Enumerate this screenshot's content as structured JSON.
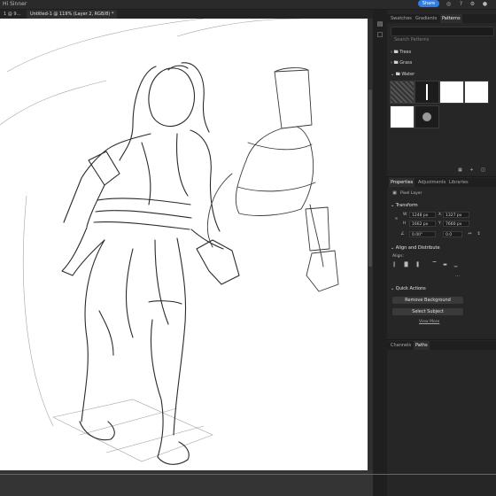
{
  "app_title": "Hi Sinner",
  "header": {
    "share_label": "Share",
    "icons": [
      "bell-icon",
      "help-icon",
      "settings-icon",
      "user-icon"
    ]
  },
  "document_tabs": {
    "prev_tab": "1 @ 9...",
    "active_tab": "Untitled-1 @ 119% (Layer 2, RGB/8) *"
  },
  "right_panel": {
    "top_tabs": [
      "Swatches",
      "Gradients",
      "Patterns"
    ],
    "search_placeholder": "Search Patterns",
    "groups": [
      "Trees",
      "Grass",
      "Water"
    ],
    "properties_tabs": [
      "Properties",
      "Adjustments",
      "Libraries"
    ],
    "layer_type": "Pixel Layer",
    "transform": {
      "section": "Transform",
      "w": "1248 px",
      "x": "1327 px",
      "h": "1662 px",
      "y": "7660 px",
      "angle": "0.00°",
      "angle_right": "0.0"
    },
    "align": {
      "section": "Align and Distribute",
      "align_label": "Align:"
    },
    "quick_actions": {
      "section": "Quick Actions",
      "remove_bg": "Remove Background",
      "select_subject": "Select Subject",
      "view_more": "View More"
    },
    "bottom_tabs": [
      "Channels",
      "Paths"
    ]
  }
}
